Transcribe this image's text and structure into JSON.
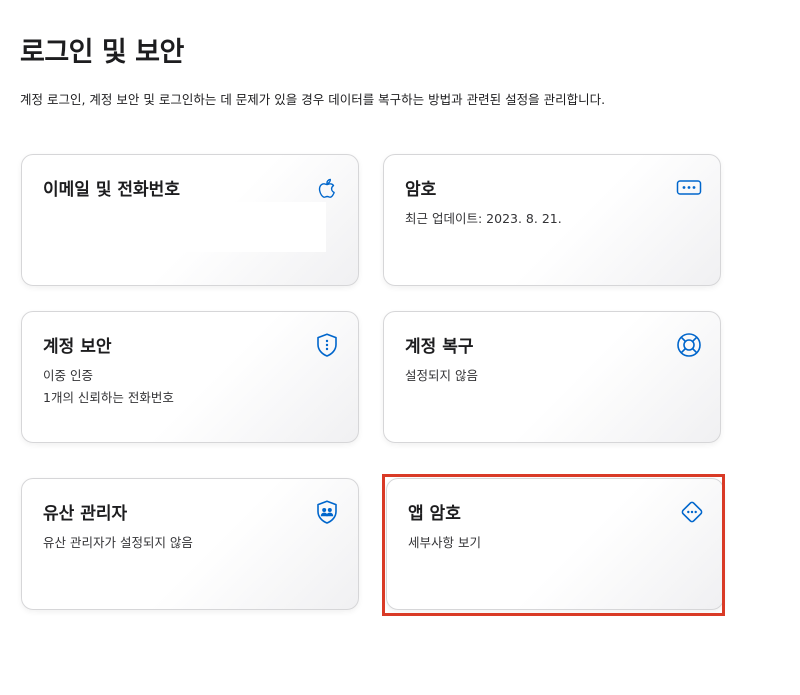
{
  "page": {
    "title": "로그인 및 보안",
    "description": "계정 로그인, 계정 보안 및 로그인하는 데 문제가 있을 경우 데이터를 복구하는 방법과 관련된 설정을 관리합니다."
  },
  "cards": {
    "email_phone": {
      "title": "이메일 및 전화번호",
      "icon": "apple-logo-icon"
    },
    "password": {
      "title": "암호",
      "subtitle": "최근 업데이트: 2023. 8. 21.",
      "icon": "password-dots-icon"
    },
    "account_security": {
      "title": "계정 보안",
      "lines": [
        "이중 인증",
        "1개의 신뢰하는 전화번호"
      ],
      "icon": "shield-icon"
    },
    "account_recovery": {
      "title": "계정 복구",
      "subtitle": "설정되지 않음",
      "icon": "lifebuoy-icon"
    },
    "legacy_contact": {
      "title": "유산 관리자",
      "subtitle": "유산 관리자가 설정되지 않음",
      "icon": "shield-people-icon"
    },
    "app_passwords": {
      "title": "앱 암호",
      "subtitle": "세부사항 보기",
      "icon": "diamond-dots-icon"
    }
  },
  "colors": {
    "accent": "#0066cc",
    "highlight": "#d93a26",
    "text": "#1d1d1f"
  }
}
